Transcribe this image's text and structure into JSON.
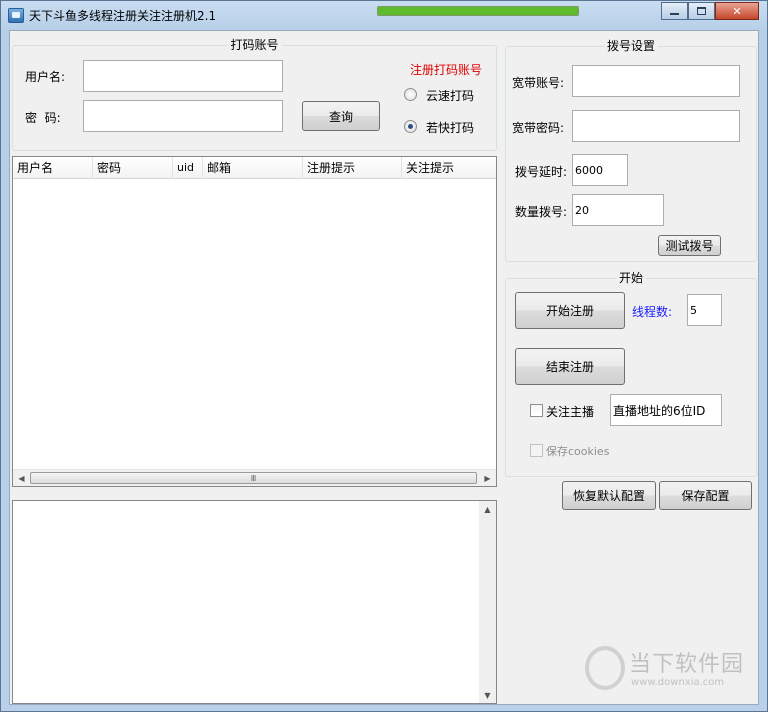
{
  "window": {
    "title": "天下斗鱼多线程注册关注注册机2.1",
    "progress_fraction": 1.0,
    "progress_color": "#5fba2e"
  },
  "captcha_group": {
    "title": "打码账号",
    "register_link": "注册打码账号",
    "register_link_color": "#e00000",
    "username_label": "用户名:",
    "username_value": "",
    "password_label": "密  码:",
    "password_value": "",
    "query_button": "查询",
    "radio_options": [
      {
        "label": "云速打码",
        "selected": false
      },
      {
        "label": "若快打码",
        "selected": true
      }
    ]
  },
  "table": {
    "columns": [
      "用户名",
      "密码",
      "uid",
      "邮箱",
      "注册提示",
      "关注提示"
    ],
    "rows": [],
    "hscroll_grip": "Ⅲ"
  },
  "log": {
    "text": ""
  },
  "dial_group": {
    "title": "拨号设置",
    "broadband_account_label": "宽带账号:",
    "broadband_account_value": "",
    "broadband_password_label": "宽带密码:",
    "broadband_password_value": "",
    "dial_delay_label": "拨号延时:",
    "dial_delay_value": "6000",
    "dial_count_label": "数量拨号:",
    "dial_count_value": "20",
    "test_dial_button": "测试拨号"
  },
  "start_group": {
    "title": "开始",
    "start_button": "开始注册",
    "stop_button": "结束注册",
    "thread_label": "线程数:",
    "thread_label_color": "#1a1aff",
    "thread_value": "5",
    "follow_label": "关注主播",
    "follow_checked": false,
    "room_id_value": "直播地址的6位ID",
    "save_cookies_label": "保存cookies",
    "save_cookies_checked": false
  },
  "bottom_buttons": {
    "restore_defaults": "恢复默认配置",
    "save_config": "保存配置"
  },
  "watermark": {
    "text": "当下软件园",
    "url": "www.downxia.com"
  }
}
